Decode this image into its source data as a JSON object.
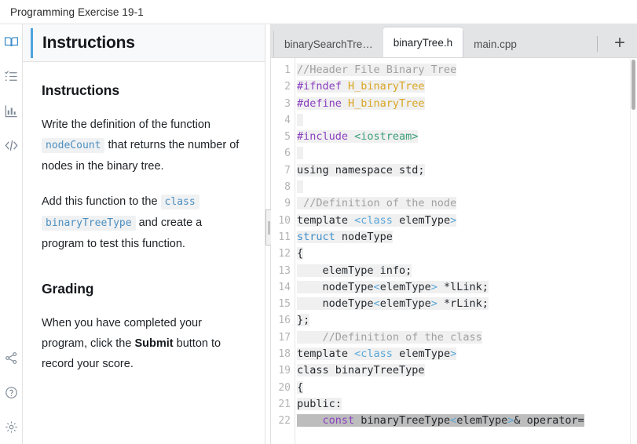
{
  "window": {
    "title": "Programming Exercise 19-1"
  },
  "rail": {
    "items": [
      {
        "name": "book-icon",
        "label": "Instructions",
        "active": true
      },
      {
        "name": "checklist-icon",
        "label": "Tasks",
        "active": false
      },
      {
        "name": "chart-icon",
        "label": "Progress",
        "active": false
      },
      {
        "name": "code-icon",
        "label": "Code",
        "active": false
      }
    ],
    "bottom_items": [
      {
        "name": "share-icon",
        "label": "Share"
      },
      {
        "name": "help-icon",
        "label": "Help"
      },
      {
        "name": "settings-icon",
        "label": "Settings"
      }
    ]
  },
  "instructions": {
    "header_title": "Instructions",
    "section1_title": "Instructions",
    "p1_a": "Write the definition of the function",
    "p1_code": "nodeCount",
    "p1_b": "that returns the number of nodes in the binary tree.",
    "p2_a": "Add this function to the",
    "p2_code1": "class",
    "p2_code2": "binaryTreeType",
    "p2_b": "and create a program to test this function.",
    "section2_title": "Grading",
    "p3_a": "When you have completed your program, click the",
    "p3_bold": "Submit",
    "p3_b": "button to record your score."
  },
  "editor": {
    "tabs": [
      {
        "label": "binarySearchTre…",
        "active": false
      },
      {
        "label": "binaryTree.h",
        "active": true
      },
      {
        "label": "main.cpp",
        "active": false
      }
    ],
    "add_tab_label": "+",
    "line_numbers": [
      "1",
      "2",
      "3",
      "4",
      "5",
      "6",
      "7",
      "8",
      "9",
      "10",
      "11",
      "12",
      "13",
      "14",
      "15",
      "16",
      "17",
      "18",
      "19",
      "20",
      "21",
      "22"
    ],
    "lines": [
      {
        "n": 1,
        "selected": false,
        "tokens": [
          {
            "t": "//Header File Binary Tree",
            "c": "t-com"
          }
        ]
      },
      {
        "n": 2,
        "selected": false,
        "tokens": [
          {
            "t": "#ifndef ",
            "c": "t-pre"
          },
          {
            "t": "H_binaryTree",
            "c": "t-mac"
          }
        ]
      },
      {
        "n": 3,
        "selected": false,
        "tokens": [
          {
            "t": "#define ",
            "c": "t-pre"
          },
          {
            "t": "H_binaryTree",
            "c": "t-mac"
          }
        ]
      },
      {
        "n": 4,
        "selected": false,
        "tokens": [
          {
            "t": " ",
            "c": "t-pln"
          }
        ]
      },
      {
        "n": 5,
        "selected": false,
        "tokens": [
          {
            "t": "#include ",
            "c": "t-pre"
          },
          {
            "t": "<iostream>",
            "c": "t-str"
          }
        ]
      },
      {
        "n": 6,
        "selected": false,
        "tokens": [
          {
            "t": " ",
            "c": "t-pln"
          }
        ]
      },
      {
        "n": 7,
        "selected": false,
        "tokens": [
          {
            "t": "using namespace std;",
            "c": "t-pln"
          }
        ]
      },
      {
        "n": 8,
        "selected": false,
        "tokens": [
          {
            "t": " ",
            "c": "t-pln"
          }
        ]
      },
      {
        "n": 9,
        "selected": false,
        "tokens": [
          {
            "t": " //Definition of the node",
            "c": "t-com"
          }
        ]
      },
      {
        "n": 10,
        "selected": false,
        "tokens": [
          {
            "t": "template ",
            "c": "t-pln"
          },
          {
            "t": "<class",
            "c": "t-ang"
          },
          {
            "t": " elemType",
            "c": "t-pln"
          },
          {
            "t": ">",
            "c": "t-ang"
          }
        ]
      },
      {
        "n": 11,
        "selected": false,
        "tokens": [
          {
            "t": "struct",
            "c": "t-kw"
          },
          {
            "t": " nodeType",
            "c": "t-pln"
          }
        ]
      },
      {
        "n": 12,
        "selected": false,
        "tokens": [
          {
            "t": "{",
            "c": "t-pln"
          }
        ]
      },
      {
        "n": 13,
        "selected": false,
        "tokens": [
          {
            "t": "    elemType info;",
            "c": "t-pln"
          }
        ]
      },
      {
        "n": 14,
        "selected": false,
        "tokens": [
          {
            "t": "    nodeType",
            "c": "t-pln"
          },
          {
            "t": "<",
            "c": "t-ang"
          },
          {
            "t": "elemType",
            "c": "t-pln"
          },
          {
            "t": ">",
            "c": "t-ang"
          },
          {
            "t": " *lLink;",
            "c": "t-pln"
          }
        ]
      },
      {
        "n": 15,
        "selected": false,
        "tokens": [
          {
            "t": "    nodeType",
            "c": "t-pln"
          },
          {
            "t": "<",
            "c": "t-ang"
          },
          {
            "t": "elemType",
            "c": "t-pln"
          },
          {
            "t": ">",
            "c": "t-ang"
          },
          {
            "t": " *rLink;",
            "c": "t-pln"
          }
        ]
      },
      {
        "n": 16,
        "selected": false,
        "tokens": [
          {
            "t": "};",
            "c": "t-pln"
          }
        ]
      },
      {
        "n": 17,
        "selected": false,
        "tokens": [
          {
            "t": "    //Definition of the class",
            "c": "t-com"
          }
        ]
      },
      {
        "n": 18,
        "selected": false,
        "tokens": [
          {
            "t": "template ",
            "c": "t-pln"
          },
          {
            "t": "<class",
            "c": "t-ang"
          },
          {
            "t": " elemType",
            "c": "t-pln"
          },
          {
            "t": ">",
            "c": "t-ang"
          }
        ]
      },
      {
        "n": 19,
        "selected": false,
        "tokens": [
          {
            "t": "class binaryTreeType",
            "c": "t-pln"
          }
        ]
      },
      {
        "n": 20,
        "selected": false,
        "tokens": [
          {
            "t": "{",
            "c": "t-pln"
          }
        ]
      },
      {
        "n": 21,
        "selected": false,
        "tokens": [
          {
            "t": "public:",
            "c": "t-pln"
          }
        ]
      },
      {
        "n": 22,
        "selected": true,
        "tokens": [
          {
            "t": "    ",
            "c": "t-pln"
          },
          {
            "t": "const",
            "c": "t-pre"
          },
          {
            "t": " binaryTreeType",
            "c": "t-pln"
          },
          {
            "t": "<",
            "c": "t-ang"
          },
          {
            "t": "elemType",
            "c": "t-pln"
          },
          {
            "t": ">",
            "c": "t-ang"
          },
          {
            "t": "& operator=",
            "c": "t-pln"
          }
        ]
      }
    ]
  }
}
